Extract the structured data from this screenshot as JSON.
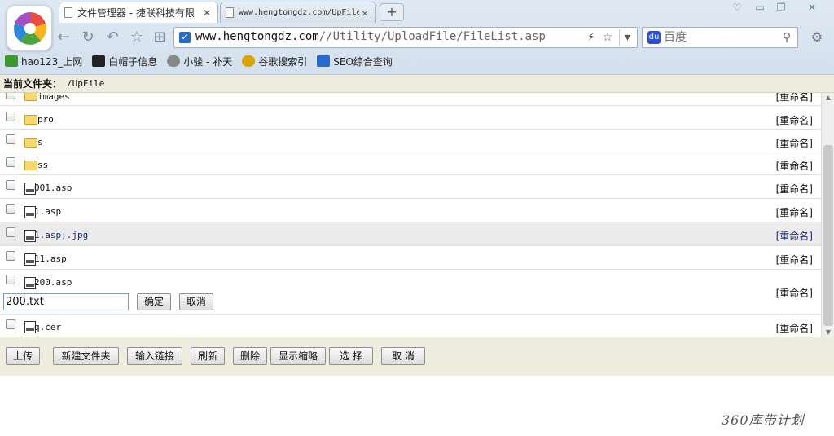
{
  "browser": {
    "tabs": [
      {
        "title": "文件管理器 - 捷联科技有限",
        "active": true
      },
      {
        "title": "www.hengtongdz.com/UpFile",
        "active": false
      }
    ],
    "new_tab": "+",
    "url": {
      "host": "www.hengtongdz.com",
      "path": "//Utility/UploadFile/FileList.asp"
    },
    "search_placeholder": "百度",
    "bookmarks": [
      {
        "label": "hao123_上网",
        "icon": "hao123-icon",
        "color": "#3a9b2a"
      },
      {
        "label": "白帽子信息",
        "icon": "whitehat-icon",
        "color": "#222222"
      },
      {
        "label": "小骏 - 补天",
        "icon": "star-icon",
        "color": "#888888"
      },
      {
        "label": "谷歌搜索引",
        "icon": "google-icon",
        "color": "#d9a400"
      },
      {
        "label": "SEO综合查询",
        "icon": "seo-icon",
        "color": "#2a6ad0"
      }
    ]
  },
  "page": {
    "current_folder_label": "当前文件夹：",
    "current_folder_value": "/UpFile",
    "rename_label": "[重命名]",
    "files": [
      {
        "name": "images",
        "type": "folder"
      },
      {
        "name": "pro",
        "type": "folder"
      },
      {
        "name": "s",
        "type": "folder"
      },
      {
        "name": "ss",
        "type": "folder"
      },
      {
        "name": "001.asp",
        "type": "file"
      },
      {
        "name": "1.asp",
        "type": "file"
      },
      {
        "name": "1.asp;.jpg",
        "type": "file",
        "highlight": true
      },
      {
        "name": "11.asp",
        "type": "file"
      },
      {
        "name": "200.asp",
        "type": "file",
        "renaming": true
      },
      {
        "name": "q.cer",
        "type": "file"
      }
    ],
    "rename_input_value": "200.txt",
    "rename_confirm": "确定",
    "rename_cancel": "取消",
    "toolbar": {
      "upload": "上传",
      "new_folder": "新建文件夹",
      "input_link": "输入链接",
      "refresh": "刷新",
      "delete": "删除",
      "show_thumbs": "显示缩略",
      "select": "选 择",
      "cancel": "取 消"
    }
  },
  "watermark": "360库带计划"
}
